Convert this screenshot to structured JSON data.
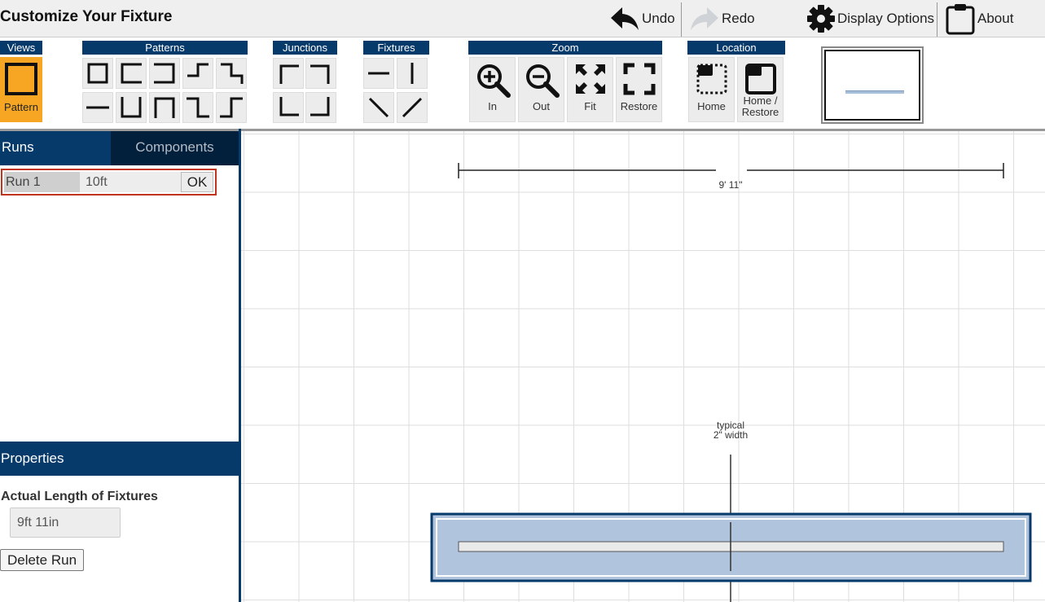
{
  "header": {
    "title": "Customize Your Fixture",
    "undo_label": "Undo",
    "redo_label": "Redo",
    "display_options_label": "Display Options",
    "about_label": "About"
  },
  "toolbar": {
    "groups": {
      "views": "Views",
      "patterns": "Patterns",
      "junctions": "Junctions",
      "fixtures": "Fixtures",
      "zoom": "Zoom",
      "location": "Location"
    },
    "views": {
      "pattern_label": "Pattern",
      "accent": "#f6a623"
    },
    "zoom": {
      "in_label": "In",
      "out_label": "Out",
      "fit_label": "Fit",
      "restore_label": "Restore"
    },
    "location": {
      "home_label": "Home",
      "home_restore_label": "Home / Restore"
    }
  },
  "left_panel": {
    "tabs": {
      "runs": "Runs",
      "components": "Components"
    },
    "run": {
      "name": "Run 1",
      "length_value": "10ft",
      "ok_label": "OK"
    },
    "properties": {
      "title": "Properties",
      "actual_length_label": "Actual Length of Fixtures",
      "actual_length_value": "9ft 11in",
      "delete_label": "Delete Run"
    }
  },
  "canvas": {
    "dimension_label": "9' 11\"",
    "width_note_line1": "typical",
    "width_note_line2": "2\" width",
    "fixture_fill": "#b0c4de",
    "fixture_border": "#063a6b"
  },
  "colors": {
    "brand_navy": "#063a6b",
    "highlight_red": "#c0341d"
  }
}
